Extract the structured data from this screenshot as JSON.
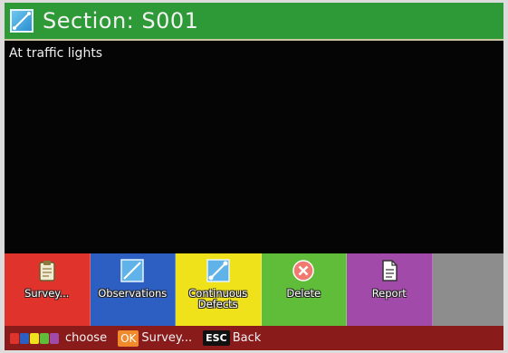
{
  "header": {
    "title": "Section: S001",
    "icon": "diagonal-line-icon"
  },
  "content": {
    "description": "At traffic lights"
  },
  "function_keys": [
    {
      "label": "Survey...",
      "color": "#e0332c",
      "icon": "clipboard-icon"
    },
    {
      "label": "Observations",
      "color": "#2d5fc2",
      "icon": "diagonal-line-icon"
    },
    {
      "label": "Continuous Defects",
      "color": "#f0e21a",
      "icon": "continuous-line-icon"
    },
    {
      "label": "Delete",
      "color": "#5fbd3a",
      "icon": "delete-x-icon"
    },
    {
      "label": "Report",
      "color": "#a24aa9",
      "icon": "document-icon"
    },
    {
      "label": "",
      "color": "#8d8d8d",
      "icon": ""
    }
  ],
  "status_bar": {
    "color_keys_label": "choose",
    "ok_key": "OK",
    "ok_label": "Survey...",
    "esc_key": "ESC",
    "esc_label": "Back",
    "swatch_colors": [
      "#e0332c",
      "#2d5fc2",
      "#f0e21a",
      "#5fbd3a",
      "#a24aa9"
    ]
  }
}
